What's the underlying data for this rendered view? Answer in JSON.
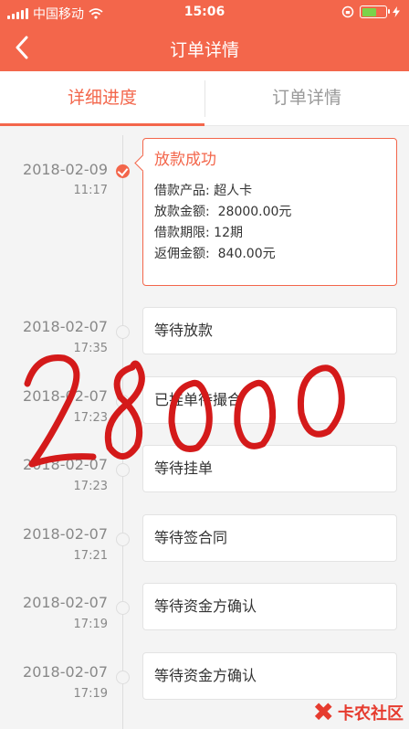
{
  "status_bar": {
    "carrier": "中国移动",
    "time": "15:06"
  },
  "nav": {
    "title": "订单详情"
  },
  "tabs": [
    {
      "label": "详细进度",
      "active": true
    },
    {
      "label": "订单详情",
      "active": false
    }
  ],
  "timeline": [
    {
      "date": "2018-02-09",
      "time": "11:17",
      "title": "放款成功",
      "status": "done",
      "details": [
        {
          "label": "借款产品:",
          "value": "超人卡"
        },
        {
          "label": "放款金额:",
          "value": "28000.00元"
        },
        {
          "label": "借款期限:",
          "value": "12期"
        },
        {
          "label": "返佣金额:",
          "value": "840.00元"
        }
      ]
    },
    {
      "date": "2018-02-07",
      "time": "17:35",
      "title": "等待放款",
      "status": "pending"
    },
    {
      "date": "2018-02-07",
      "time": "17:23",
      "title": "已挂单待撮合",
      "status": "pending"
    },
    {
      "date": "2018-02-07",
      "time": "17:23",
      "title": "等待挂单",
      "status": "pending"
    },
    {
      "date": "2018-02-07",
      "time": "17:21",
      "title": "等待签合同",
      "status": "pending"
    },
    {
      "date": "2018-02-07",
      "time": "17:19",
      "title": "等待资金方确认",
      "status": "pending"
    },
    {
      "date": "2018-02-07",
      "time": "17:19",
      "title": "等待资金方确认",
      "status": "pending"
    }
  ],
  "watermark": {
    "text": "28000",
    "color": "#d41a1a"
  },
  "logo": {
    "text": "卡农社区"
  },
  "colors": {
    "accent": "#f3664b"
  }
}
